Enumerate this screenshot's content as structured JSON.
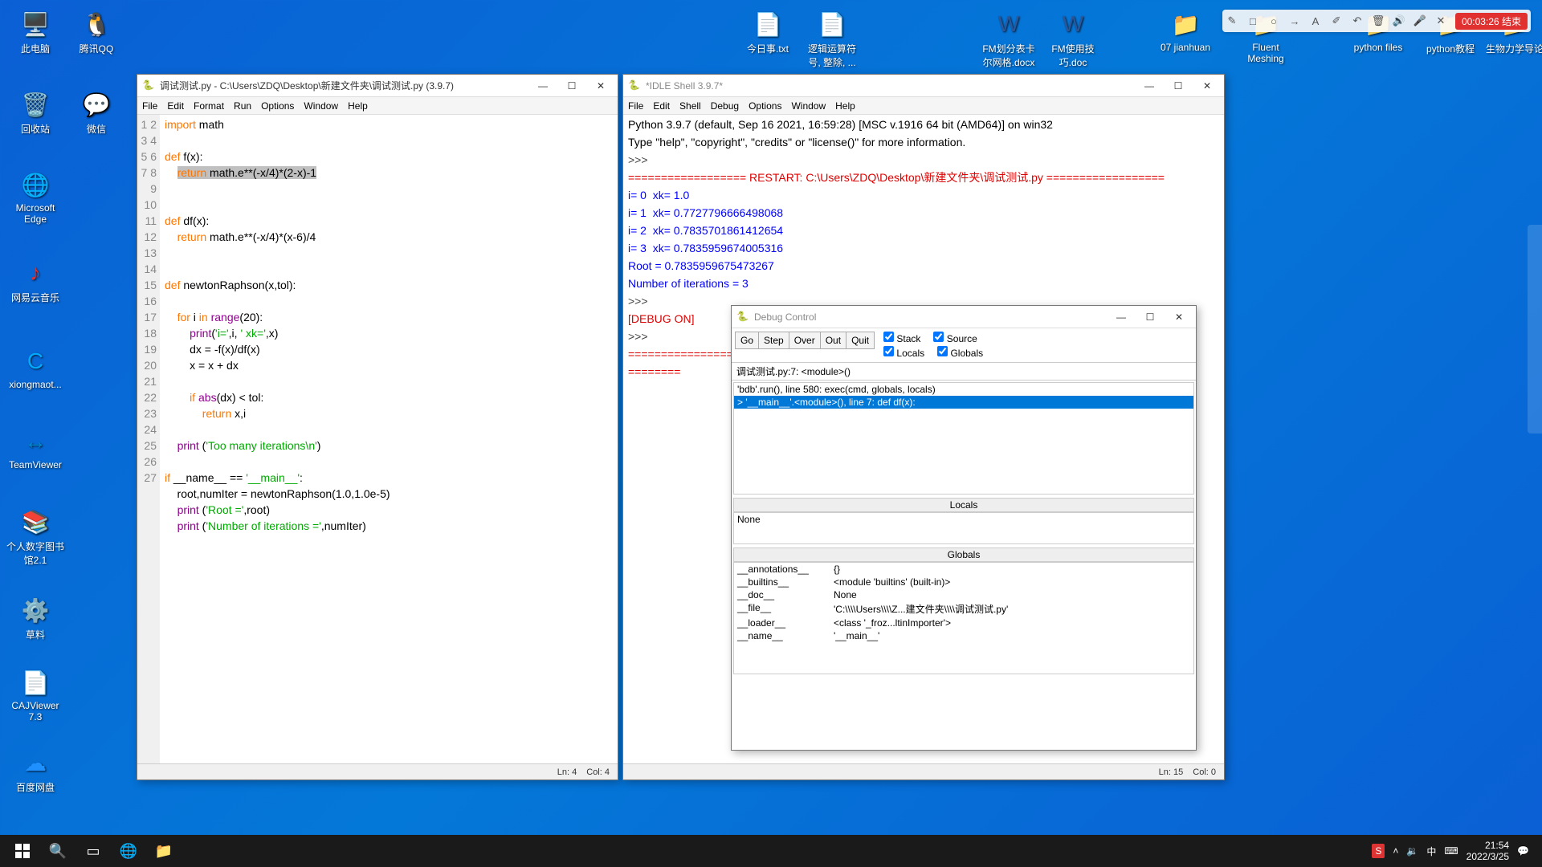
{
  "desktop_icons": {
    "left": [
      {
        "label": "此电脑"
      },
      {
        "label": "腾讯QQ"
      },
      {
        "label": "回收站"
      },
      {
        "label": "微信"
      },
      {
        "label": "Microsoft Edge"
      },
      {
        "label": "网易云音乐"
      },
      {
        "label": "xiongmaot..."
      },
      {
        "label": "TeamViewer"
      },
      {
        "label": "个人数字图书馆2.1"
      },
      {
        "label": "草料"
      },
      {
        "label": "CAJViewer 7.3"
      },
      {
        "label": "百度网盘"
      }
    ],
    "top": [
      {
        "label": "今日事.txt"
      },
      {
        "label": "逻辑运算符号, 整除, ..."
      },
      {
        "label": "FM划分表卡尔网格.docx"
      },
      {
        "label": "FM使用技巧.doc"
      },
      {
        "label": "07 jianhuan"
      },
      {
        "label": "Fluent Meshing"
      },
      {
        "label": "python files"
      },
      {
        "label": "python教程"
      },
      {
        "label": "生物力学导论"
      }
    ]
  },
  "editor": {
    "title": "调试测试.py - C:\\Users\\ZDQ\\Desktop\\新建文件夹\\调试测试.py (3.9.7)",
    "menus": [
      "File",
      "Edit",
      "Format",
      "Run",
      "Options",
      "Window",
      "Help"
    ],
    "status": {
      "ln": "Ln: 4",
      "col": "Col: 4"
    }
  },
  "shell": {
    "title": "*IDLE Shell 3.9.7*",
    "menus": [
      "File",
      "Edit",
      "Shell",
      "Debug",
      "Options",
      "Window",
      "Help"
    ],
    "banner1": "Python 3.9.7 (default, Sep 16 2021, 16:59:28) [MSC v.1916 64 bit (AMD64)] on win32",
    "banner2": "Type \"help\", \"copyright\", \"credits\" or \"license()\" for more information.",
    "restart": "================== RESTART: C:\\Users\\ZDQ\\Desktop\\新建文件夹\\调试测试.py ==================",
    "out_lines": [
      "i= 0  xk= 1.0",
      "i= 1  xk= 0.7727796666498068",
      "i= 2  xk= 0.7835701861412654",
      "i= 3  xk= 0.7835959674005316",
      "Root = 0.7835959675473267",
      "Number of iterations = 3"
    ],
    "debug_on": "[DEBUG ON]",
    "trailing": "=============================================\n========",
    "status": {
      "ln": "Ln: 15",
      "col": "Col: 0"
    }
  },
  "debug": {
    "title": "Debug Control",
    "buttons": [
      "Go",
      "Step",
      "Over",
      "Out",
      "Quit"
    ],
    "checks": {
      "stack": "Stack",
      "source": "Source",
      "locals": "Locals",
      "globals": "Globals"
    },
    "current": "调试测试.py:7: <module>()",
    "stack": [
      "'bdb'.run(), line 580: exec(cmd, globals, locals)",
      "> '__main__'.<module>(), line 7: def df(x):"
    ],
    "locals_title": "Locals",
    "locals_none": "None",
    "globals_title": "Globals",
    "globals": [
      {
        "name": "__annotations__",
        "val": "{}"
      },
      {
        "name": "__builtins__",
        "val": "<module 'builtins' (built-in)>"
      },
      {
        "name": "__doc__",
        "val": "None"
      },
      {
        "name": "__file__",
        "val": "'C:\\\\\\\\Users\\\\\\\\Z...建文件夹\\\\\\\\调试测试.py'"
      },
      {
        "name": "__loader__",
        "val": "<class '_froz...ltinImporter'>"
      },
      {
        "name": "__name__",
        "val": "'__main__'"
      }
    ]
  },
  "rec": {
    "time": "00:03:26 结束"
  },
  "taskbar": {
    "clock_time": "21:54",
    "clock_date": "2022/3/25"
  }
}
